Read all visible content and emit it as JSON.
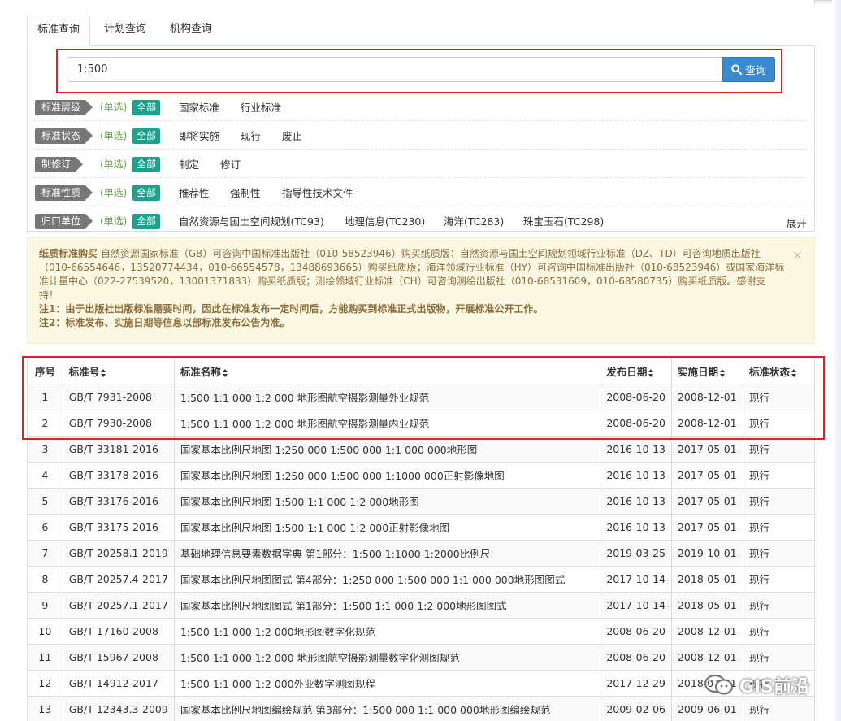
{
  "tabs": [
    {
      "label": "标准查询",
      "active": true
    },
    {
      "label": "计划查询",
      "active": false
    },
    {
      "label": "机构查询",
      "active": false
    }
  ],
  "search": {
    "value": "1:500",
    "button_label": "查询"
  },
  "filters": [
    {
      "label": "标准层级",
      "mode": "(单选)",
      "all": "全部",
      "options": [
        "国家标准",
        "行业标准"
      ]
    },
    {
      "label": "标准状态",
      "mode": "(单选)",
      "all": "全部",
      "options": [
        "即将实施",
        "现行",
        "废止"
      ]
    },
    {
      "label": "制修订",
      "mode": "(单选)",
      "all": "全部",
      "options": [
        "制定",
        "修订"
      ]
    },
    {
      "label": "标准性质",
      "mode": "(单选)",
      "all": "全部",
      "options": [
        "推荐性",
        "强制性",
        "指导性技术文件"
      ]
    },
    {
      "label": "归口单位",
      "mode": "(单选)",
      "all": "全部",
      "options": [
        "自然资源与国土空间规划(TC93)",
        "地理信息(TC230)",
        "海洋(TC283)",
        "珠宝玉石(TC298)"
      ]
    }
  ],
  "expand_label": "展开",
  "notice": {
    "title": "纸质标准购买",
    "body": "自然资源国家标准（GB）可咨询中国标准出版社（010-58523946）购买纸质版；自然资源与国土空间规划领域行业标准（DZ、TD）可咨询地质出版社（010-66554646，13520774434，010-66554578，13488693665）购买纸质版；海洋领域行业标准（HY）可咨询中国标准出版社（010-68523946）或国家海洋标准计量中心（022-27539520，13001371833）购买纸质版；测绘领域行业标准（CH）可咨询测绘出版社（010-68531609，010-68580735）购买纸质版。感谢支持！",
    "note1": "注1：由于出版社出版标准需要时间，因此在标准发布一定时间后，方能购买到标准正式出版物，开展标准公开工作。",
    "note2": "注2：标准发布、实施日期等信息以部标准发布公告为准。",
    "close": "×"
  },
  "table": {
    "headers": [
      "序号",
      "标准号",
      "标准名称",
      "发布日期",
      "实施日期",
      "标准状态"
    ],
    "rows": [
      [
        "1",
        "GB/T 7931-2008",
        "1:500 1:1 000 1:2 000 地形图航空摄影测量外业规范",
        "2008-06-20",
        "2008-12-01",
        "现行"
      ],
      [
        "2",
        "GB/T 7930-2008",
        "1:500 1:1 000 1:2 000 地形图航空摄影测量内业规范",
        "2008-06-20",
        "2008-12-01",
        "现行"
      ],
      [
        "3",
        "GB/T 33181-2016",
        "国家基本比例尺地图 1:250 000 1:500 000 1:1 000 000地形图",
        "2016-10-13",
        "2017-05-01",
        "现行"
      ],
      [
        "4",
        "GB/T 33178-2016",
        "国家基本比例尺地图 1:250 000 1:500 000 1:1000 000正射影像地图",
        "2016-10-13",
        "2017-05-01",
        "现行"
      ],
      [
        "5",
        "GB/T 33176-2016",
        "国家基本比例尺地图 1:500 1:1 000 1:2 000地形图",
        "2016-10-13",
        "2017-05-01",
        "现行"
      ],
      [
        "6",
        "GB/T 33175-2016",
        "国家基本比例尺地图 1:500 1:1 000 1:2 000正射影像地图",
        "2016-10-13",
        "2017-05-01",
        "现行"
      ],
      [
        "7",
        "GB/T 20258.1-2019",
        "基础地理信息要素数据字典 第1部分：1:500 1:1000 1:2000比例尺",
        "2019-03-25",
        "2019-10-01",
        "现行"
      ],
      [
        "8",
        "GB/T 20257.4-2017",
        "国家基本比例尺地图图式 第4部分：1:250 000 1:500 000 1:1 000 000地形图图式",
        "2017-10-14",
        "2018-05-01",
        "现行"
      ],
      [
        "9",
        "GB/T 20257.1-2017",
        "国家基本比例尺地图图式 第1部分：1:500 1:1 000 1:2 000地形图图式",
        "2017-10-14",
        "2018-05-01",
        "现行"
      ],
      [
        "10",
        "GB/T 17160-2008",
        "1:500 1:1 000 1:2 000地形图数字化规范",
        "2008-06-20",
        "2008-12-01",
        "现行"
      ],
      [
        "11",
        "GB/T 15967-2008",
        "1:500 1:1 000 1:2 000 地形图航空摄影测量数字化测图规范",
        "2008-06-20",
        "2008-12-01",
        "现行"
      ],
      [
        "12",
        "GB/T 14912-2017",
        "1:500 1:1 000 1:2 000外业数字测图规程",
        "2017-12-29",
        "2018-07-01",
        "现行"
      ],
      [
        "13",
        "GB/T 12343.3-2009",
        "国家基本比例尺地图编绘规范 第3部分：1:500 000 1:1 000 000地形图编绘规范",
        "2009-02-06",
        "2009-06-01",
        "现行"
      ]
    ]
  },
  "watermark": "GIS前沿"
}
